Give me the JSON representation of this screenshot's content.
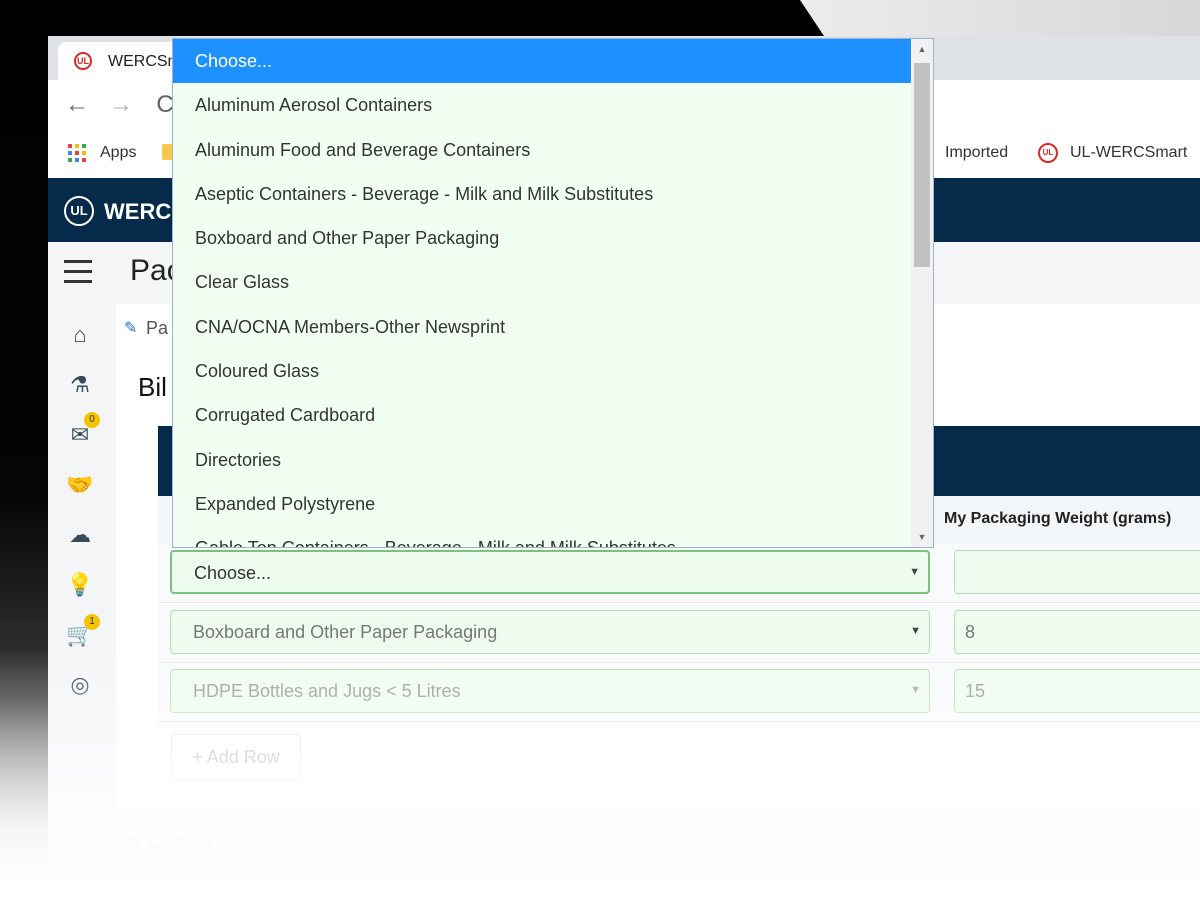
{
  "browser": {
    "tab_title": "WERCSm",
    "tab_icon": "ul-logo-icon",
    "nav": {
      "back": "←",
      "forward": "→",
      "reload": "C"
    },
    "bookmarks": [
      {
        "label": "Apps"
      },
      {
        "label": "Imported"
      },
      {
        "label": "UL-WERCSmart"
      }
    ]
  },
  "app": {
    "logo_text": "WERCS",
    "page_title": "Pac",
    "breadcrumb": "Pa",
    "section_title": "Bil",
    "sidebar_badges": {
      "mail": "0",
      "cart": "1"
    }
  },
  "table": {
    "column_header": "My Packaging Weight (grams)",
    "rows": [
      {
        "material": "Choose...",
        "weight": ""
      },
      {
        "material": "Boxboard and Other Paper Packaging",
        "weight": "8"
      },
      {
        "material": "HDPE Bottles and Jugs < 5 Litres",
        "weight": "15"
      }
    ],
    "add_row_label": "+ Add Row",
    "footer_ghost": "✎ CONER"
  },
  "dropdown": {
    "options": [
      "Choose...",
      "Aluminum Aerosol Containers",
      "Aluminum Food and Beverage Containers",
      "Aseptic Containers - Beverage - Milk and Milk Substitutes",
      "Boxboard and Other Paper Packaging",
      "Clear Glass",
      "CNA/OCNA Members-Other Newsprint",
      "Coloured Glass",
      "Corrugated Cardboard",
      "Directories",
      "Expanded Polystyrene",
      "Gable Top Containers - Beverage - Milk and Milk Substitutes"
    ]
  },
  "colors": {
    "appbar": "#052a4a",
    "selection": "#1e90ff",
    "dropdown_bg": "#f0fff2",
    "badge": "#f5c400"
  }
}
